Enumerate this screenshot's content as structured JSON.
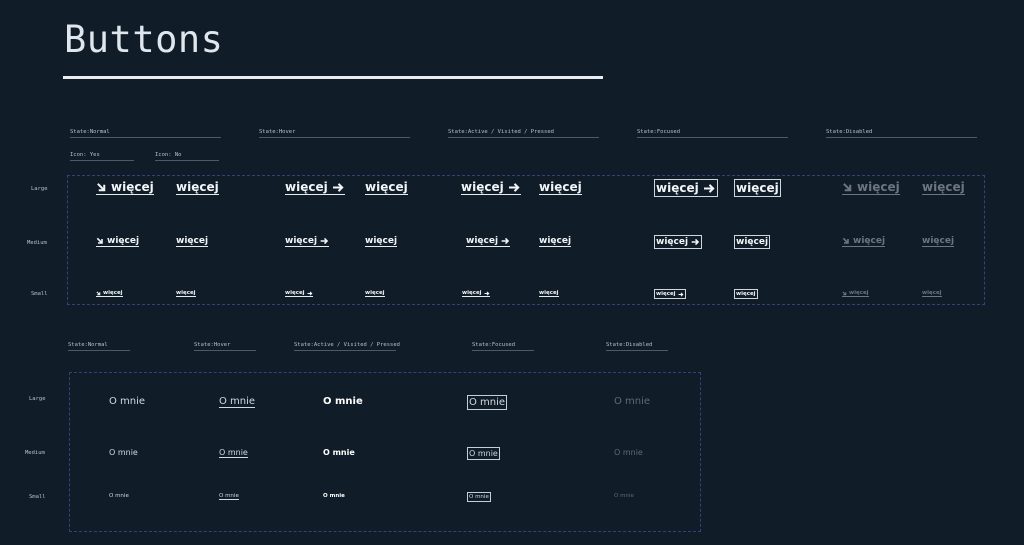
{
  "page": {
    "title": "Buttons"
  },
  "section1": {
    "states": [
      "State:Normal",
      "State:Hover",
      "State:Active / Visited / Pressed",
      "State:Focused",
      "State:Disabled"
    ],
    "icon_labels": [
      "Icon: Yes",
      "Icon: No"
    ],
    "sizes": [
      "Large",
      "Medium",
      "Small"
    ],
    "button_label": "więcej"
  },
  "section2": {
    "states": [
      "State:Normal",
      "State:Hover",
      "State:Active / Visited / Pressed",
      "State:Focused",
      "State:Disabled"
    ],
    "sizes": [
      "Large",
      "Medium",
      "Small"
    ],
    "link_label": "O mnie"
  },
  "icons": {
    "arrow_diagonal": "arrow-down-right-icon",
    "arrow_right": "arrow-right-icon"
  },
  "colors": {
    "background": "#101c27",
    "text": "#e8edf2",
    "disabled": "#6c7580",
    "frame": "#3a3f7a"
  }
}
